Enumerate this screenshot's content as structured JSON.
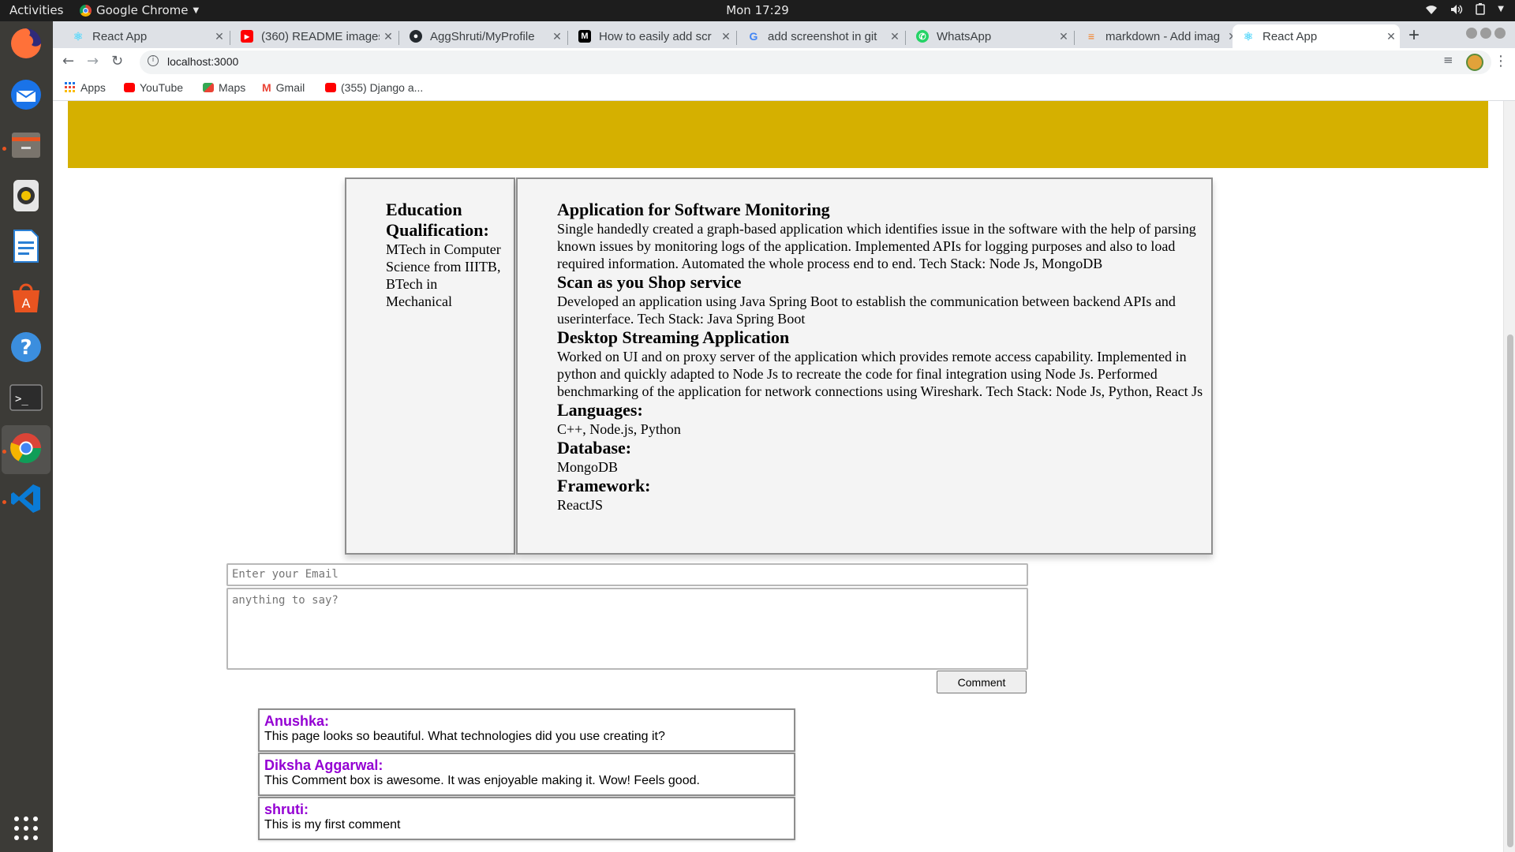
{
  "topbar": {
    "activities": "Activities",
    "app_name": "Google Chrome",
    "clock": "Mon 17:29"
  },
  "dock": {
    "icons": [
      "firefox-icon",
      "thunderbird-icon",
      "files-icon",
      "rhythmbox-icon",
      "libreoffice-writer-icon",
      "software-center-icon",
      "help-icon",
      "terminal-icon",
      "chrome-icon",
      "vscode-icon",
      "show-apps-icon"
    ]
  },
  "tabs": [
    {
      "title": "React App",
      "active": false
    },
    {
      "title": "(360) README images",
      "active": false
    },
    {
      "title": "AggShruti/MyProfile",
      "active": false
    },
    {
      "title": "How to easily add scr",
      "active": false
    },
    {
      "title": "add screenshot in git",
      "active": false
    },
    {
      "title": "WhatsApp",
      "active": false
    },
    {
      "title": "markdown - Add imag",
      "active": false
    },
    {
      "title": "React App",
      "active": true
    }
  ],
  "toolbar": {
    "url": "localhost:3000"
  },
  "bookmarks": [
    {
      "label": "Apps"
    },
    {
      "label": "YouTube"
    },
    {
      "label": "Maps"
    },
    {
      "label": "Gmail"
    },
    {
      "label": "(355) Django a..."
    }
  ],
  "colors": {
    "banner": "#d5b000",
    "author": "#9400d3"
  },
  "education": {
    "heading": "Education Qualification:",
    "text": "MTech in Computer Science from IIITB, BTech in Mechanical"
  },
  "experience": [
    {
      "title": "Application for Software Monitoring",
      "text": "Single handedly created a graph-based application which identifies issue in the software with the help of parsing known issues by monitoring logs of the application. Implemented APIs for logging purposes and also to load required information. Automated the whole process end to end. Tech Stack: Node Js, MongoDB"
    },
    {
      "title": "Scan as you Shop service",
      "text": "Developed an application using Java Spring Boot to establish the communication between backend APIs and userinterface. Tech Stack: Java Spring Boot"
    },
    {
      "title": "Desktop Streaming Application",
      "text": "Worked on UI and on proxy server of the application which provides remote access capability. Implemented in python and quickly adapted to Node Js to recreate the code for final integration using Node Js. Performed benchmarking of the application for network connections using Wireshark. Tech Stack: Node Js, Python, React Js"
    }
  ],
  "skills": [
    {
      "label": "Languages:",
      "value": "C++, Node.js, Python"
    },
    {
      "label": "Database:",
      "value": "MongoDB"
    },
    {
      "label": "Framework:",
      "value": "ReactJS"
    }
  ],
  "form": {
    "email_placeholder": "Enter your Email",
    "comment_placeholder": "anything to say?",
    "button_label": "Comment"
  },
  "comments": [
    {
      "author": "Anushka:",
      "text": "This page looks so beautiful. What technologies did you use creating it?"
    },
    {
      "author": "Diksha Aggarwal:",
      "text": "This Comment box is awesome. It was enjoyable making it. Wow! Feels good."
    },
    {
      "author": "shruti:",
      "text": "This is my first comment"
    }
  ]
}
